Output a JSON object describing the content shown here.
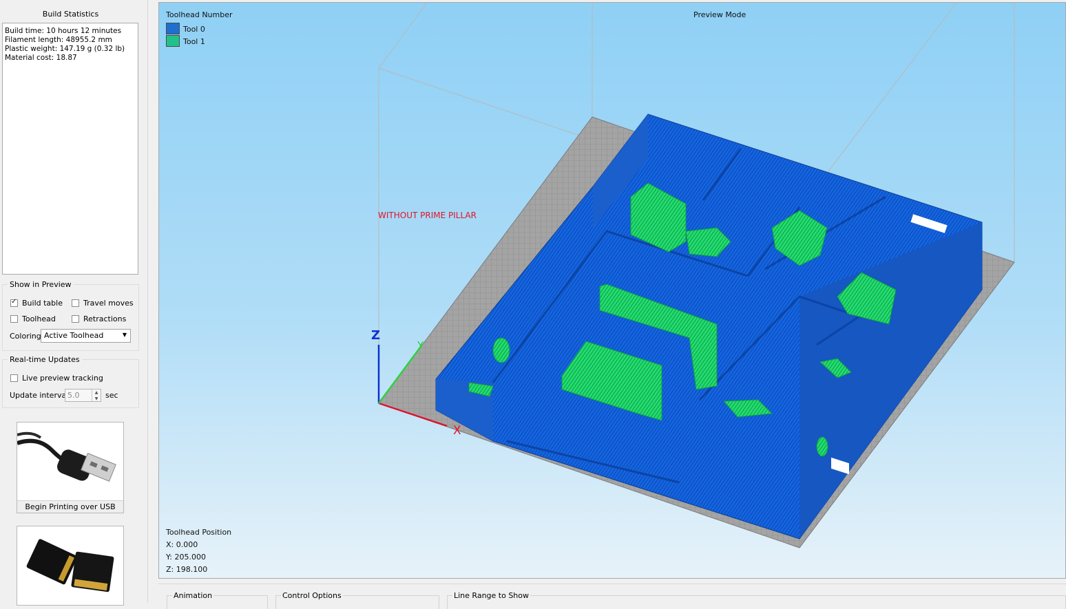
{
  "build_statistics": {
    "title": "Build Statistics",
    "lines": [
      "Build time: 10 hours 12 minutes",
      "Filament length: 48955.2 mm",
      "Plastic weight: 147.19 g (0.32 lb)",
      "Material cost: 18.87"
    ]
  },
  "show_in_preview": {
    "title": "Show in Preview",
    "build_table": {
      "label": "Build table",
      "checked": true
    },
    "travel_moves": {
      "label": "Travel moves",
      "checked": false
    },
    "toolhead": {
      "label": "Toolhead",
      "checked": false
    },
    "retractions": {
      "label": "Retractions",
      "checked": false
    },
    "coloring_label": "Coloring",
    "coloring_value": "Active Toolhead"
  },
  "realtime_updates": {
    "title": "Real-time Updates",
    "live_preview": {
      "label": "Live preview tracking",
      "checked": false
    },
    "update_interval_label": "Update interval",
    "update_interval_value": "5.0",
    "update_interval_unit": "sec"
  },
  "usb_button": {
    "label": "Begin Printing over USB",
    "icon": "usb-cable-icon"
  },
  "sd_button": {
    "icon": "sd-card-icon"
  },
  "viewport": {
    "legend_title": "Toolhead Number",
    "legend": [
      {
        "label": "Tool 0",
        "color": "#1f6fd0"
      },
      {
        "label": "Tool 1",
        "color": "#21c28a"
      }
    ],
    "mode_label": "Preview Mode",
    "annotation": "WITHOUT PRIME PILLAR",
    "annotation_color": "#e0142a",
    "axis_labels": {
      "x": "X",
      "y": "Y",
      "z": "Z"
    },
    "toolhead_position": {
      "title": "Toolhead Position",
      "x": "X: 0.000",
      "y": "Y: 205.000",
      "z": "Z: 198.100"
    },
    "colors": {
      "tool0": "#1466e6",
      "tool1": "#22e070",
      "bed": "#9a9a9a",
      "accent_red": "#e0142a"
    }
  },
  "bottom_panel": {
    "animation": "Animation",
    "control_options": "Control Options",
    "line_range": "Line Range to Show"
  }
}
